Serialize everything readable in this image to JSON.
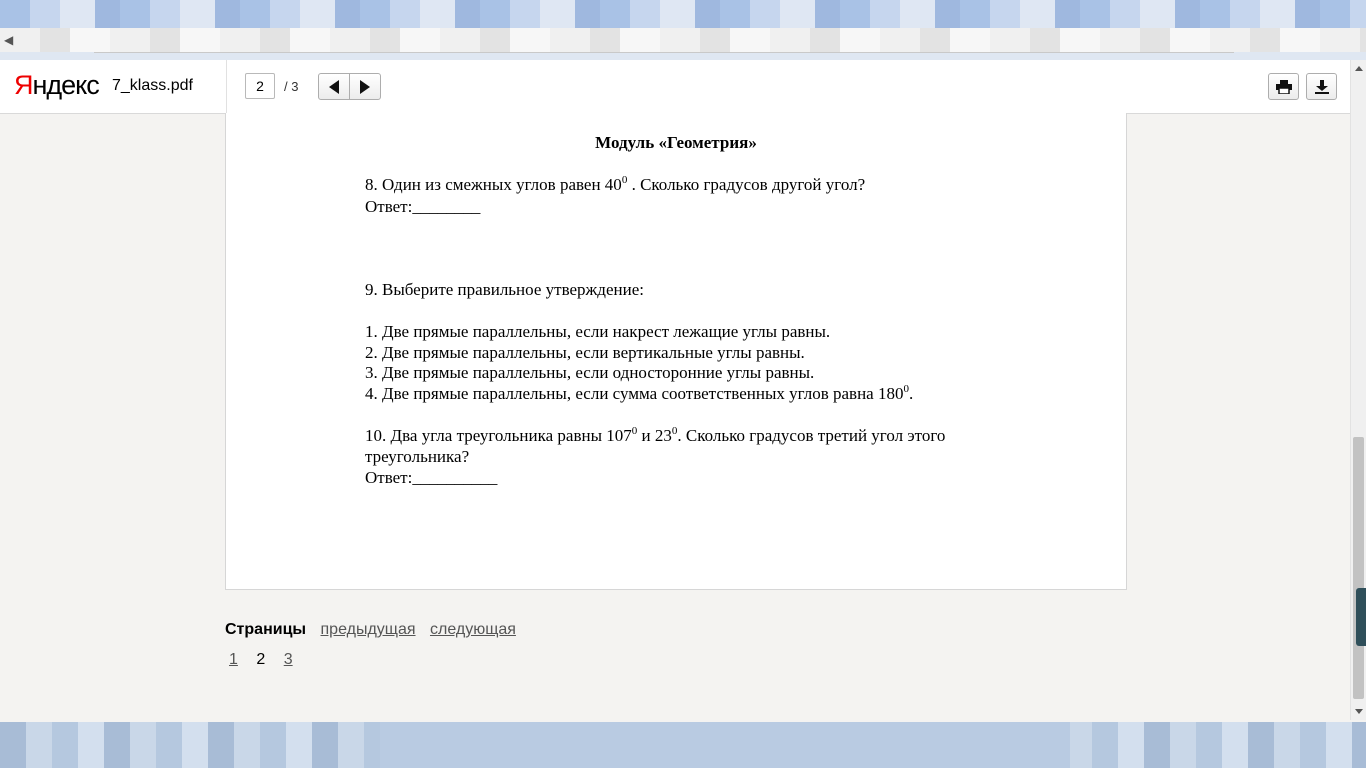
{
  "toolbar": {
    "logo_first": "Я",
    "logo_rest": "ндекс",
    "filename": "7_klass.pdf",
    "page_current": "2",
    "page_total": "/ 3"
  },
  "document": {
    "title": "Модуль «Геометрия»",
    "q8": {
      "text_a": "8.  Один из  смежных углов равен 40",
      "sup_a": "0",
      "text_b": " . Сколько градусов другой угол?",
      "answer": "Ответ:________"
    },
    "q9": {
      "text": "9.  Выберите правильное утверждение:",
      "options": [
        "1. Две прямые параллельны, если накрест лежащие углы равны.",
        "2. Две прямые параллельны, если вертикальные углы равны.",
        "3. Две прямые параллельны, если односторонние углы равны."
      ],
      "option4_a": "4. Две прямые параллельны, если  сумма соответственных углов равна 180",
      "option4_sup": "0",
      "option4_b": "."
    },
    "q10": {
      "text_a": "10.  Два угла  треугольника  равны 107",
      "sup_a": "0",
      "text_b": " и 23",
      "sup_b": "0",
      "text_c": ". Сколько градусов третий угол этого",
      "line2": "треугольника?",
      "answer": "Ответ:__________"
    }
  },
  "pager": {
    "label": "Страницы",
    "prev": "предыдущая",
    "next": "следующая",
    "pages": [
      "1",
      "2",
      "3"
    ]
  },
  "icons": {
    "prev": "triangle-left-icon",
    "next": "triangle-right-icon",
    "print": "printer-icon",
    "download": "download-icon"
  },
  "colors": {
    "logo_accent": "#ee0000",
    "background": "#f4f3f1",
    "link": "#555555"
  }
}
